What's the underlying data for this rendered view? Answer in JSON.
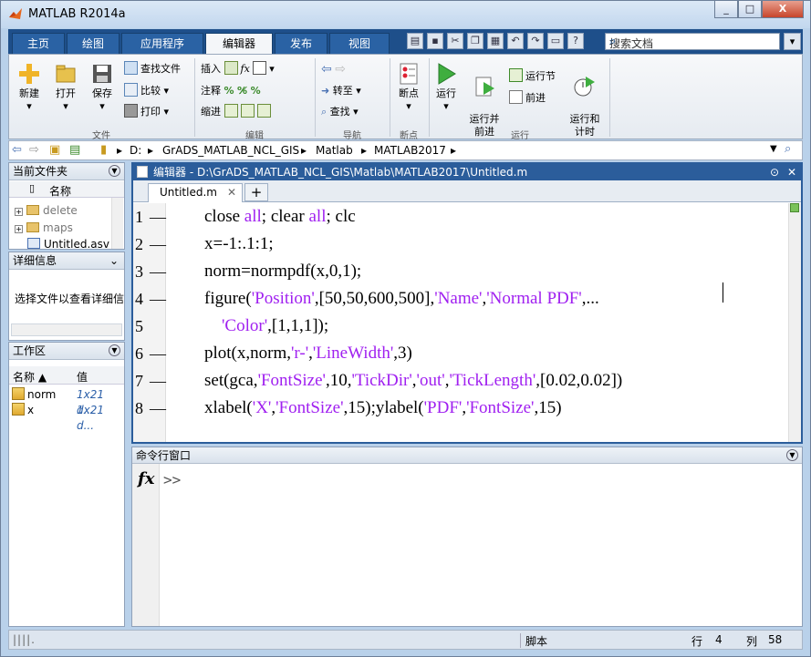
{
  "window": {
    "title": "MATLAB R2014a",
    "min": "_",
    "max": "□",
    "close": "X"
  },
  "tabs": [
    "主页",
    "绘图",
    "应用程序",
    "编辑器",
    "发布",
    "视图"
  ],
  "search": {
    "placeholder": "搜索文档"
  },
  "ribbon": {
    "file": {
      "new": "新建",
      "open": "打开",
      "save": "保存",
      "find_files": "查找文件",
      "compare": "比较",
      "print": "打印",
      "group": "文件"
    },
    "edit": {
      "insert": "插入",
      "comment": "注释",
      "indent": "缩进",
      "group": "编辑"
    },
    "navigate": {
      "goto": "转至",
      "find": "查找",
      "group": "导航"
    },
    "breakpoints": {
      "label": "断点",
      "group": "断点"
    },
    "run": {
      "run": "运行",
      "run_advance": "运行并\n前进",
      "run_section": "运行节",
      "advance": "前进",
      "run_time": "运行和\n计时",
      "group": "运行"
    }
  },
  "address": {
    "parts": [
      "D:",
      "GrADS_MATLAB_NCL_GIS",
      "Matlab",
      "MATLAB2017"
    ]
  },
  "current_folder": {
    "title": "当前文件夹",
    "col_name": "名称",
    "items": [
      "delete",
      "maps",
      "Untitled.asv"
    ]
  },
  "details": {
    "title": "详细信息",
    "text": "选择文件以查看详细信"
  },
  "workspace": {
    "title": "工作区",
    "col_name": "名称 ▲",
    "col_value": "值",
    "rows": [
      {
        "name": "norm",
        "value": "1x21 d..."
      },
      {
        "name": "x",
        "value": "1x21 d..."
      }
    ]
  },
  "editor": {
    "title": "编辑器 - D:\\GrADS_MATLAB_NCL_GIS\\Matlab\\MATLAB2017\\Untitled.m",
    "tab": "Untitled.m",
    "tab_close": "✕",
    "plus": "+",
    "lines": [
      {
        "n": "1",
        "dash": "—",
        "code": [
          [
            "close ",
            ""
          ],
          [
            "all",
            "kw"
          ],
          [
            "; clear ",
            ""
          ],
          [
            "all",
            "kw"
          ],
          [
            "; clc",
            ""
          ]
        ]
      },
      {
        "n": "2",
        "dash": "—",
        "code": [
          [
            "x=-1:.1:1;",
            ""
          ]
        ]
      },
      {
        "n": "3",
        "dash": "—",
        "code": [
          [
            "norm=normpdf(x,0,1);",
            ""
          ]
        ]
      },
      {
        "n": "4",
        "dash": "—",
        "code": [
          [
            "figure(",
            ""
          ],
          [
            "'Position'",
            "str"
          ],
          [
            ",[50,50,600,500],",
            ""
          ],
          [
            "'Name'",
            "str"
          ],
          [
            ",",
            ""
          ],
          [
            "'Normal PDF'",
            "str"
          ],
          [
            ",...",
            ""
          ]
        ]
      },
      {
        "n": "5",
        "dash": "",
        "code": [
          [
            "    ",
            ""
          ],
          [
            "'Color'",
            "str"
          ],
          [
            ",[1,1,1]);",
            ""
          ]
        ]
      },
      {
        "n": "6",
        "dash": "—",
        "code": [
          [
            "plot(x,norm,",
            ""
          ],
          [
            "'r-'",
            "str"
          ],
          [
            ",",
            ""
          ],
          [
            "'LineWidth'",
            "str"
          ],
          [
            ",3)",
            ""
          ]
        ]
      },
      {
        "n": "7",
        "dash": "—",
        "code": [
          [
            "set(gca,",
            ""
          ],
          [
            "'FontSize'",
            "str"
          ],
          [
            ",10,",
            ""
          ],
          [
            "'TickDir'",
            "str"
          ],
          [
            ",",
            ""
          ],
          [
            "'out'",
            "str"
          ],
          [
            ",",
            ""
          ],
          [
            "'TickLength'",
            "str"
          ],
          [
            ",[0.02,0.02])",
            ""
          ]
        ]
      },
      {
        "n": "8",
        "dash": "—",
        "code": [
          [
            "xlabel(",
            ""
          ],
          [
            "'X'",
            "str"
          ],
          [
            ",",
            ""
          ],
          [
            "'FontSize'",
            "str"
          ],
          [
            ",15);ylabel(",
            ""
          ],
          [
            "'PDF'",
            "str"
          ],
          [
            ",",
            ""
          ],
          [
            "'FontSize'",
            "str"
          ],
          [
            ",15)",
            ""
          ]
        ]
      }
    ]
  },
  "command_window": {
    "title": "命令行窗口",
    "fx": "fx",
    "prompt": ">>"
  },
  "status": {
    "mode": "脚本",
    "row_label": "行",
    "row": "4",
    "col_label": "列",
    "col": "58"
  }
}
